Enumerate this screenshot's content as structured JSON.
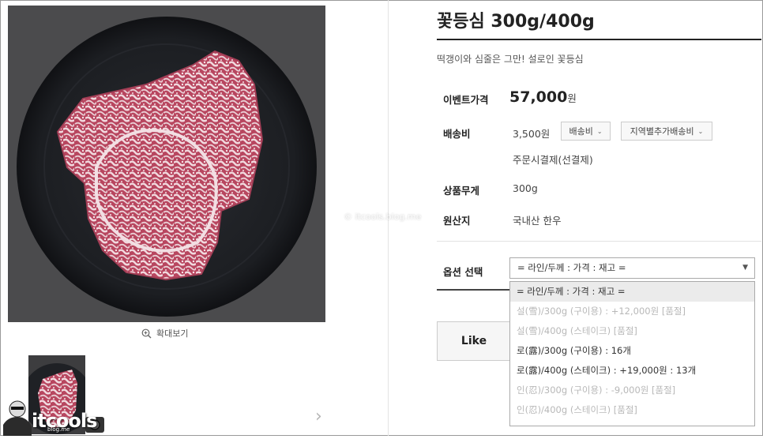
{
  "product": {
    "title": "꽃등심 300g/400g",
    "subtitle": "떡갱이와 심줄은 그만! 설로인 꽃등심"
  },
  "gallery": {
    "zoom_label": "확대보기",
    "next_icon": "chevron-right-icon"
  },
  "details": {
    "event_price_label": "이벤트가격",
    "event_price": "57,000",
    "price_unit": "원",
    "shipping_label": "배송비",
    "shipping_value": "3,500원",
    "shipping_select": "배송비",
    "regional_select": "지역별추가배송비",
    "shipping_note": "주문시결제(선결제)",
    "weight_label": "상품무게",
    "weight_value": "300g",
    "origin_label": "원산지",
    "origin_value": "국내산 한우"
  },
  "options": {
    "label": "옵션 선택",
    "selected": "= 라인/두께 : 가격 : 재고 =",
    "items": [
      "= 라인/두께 : 가격 : 재고 =",
      "설(雪)/300g (구이용) : +12,000원 [품절]",
      "설(雪)/400g (스테이크) [품절]",
      "로(露)/300g (구이용) : 16개",
      "로(露)/400g (스테이크) : +19,000원 : 13개",
      "인(忍)/300g (구이용) : -9,000원 [품절]",
      "인(忍)/400g (스테이크) [품절]"
    ]
  },
  "actions": {
    "like_label": "Like"
  },
  "watermark": {
    "center_text": "© itcools.blog.me",
    "logo_text": "itcools",
    "logo_sub": "blog.me"
  },
  "colors": {
    "accent": "#222222",
    "disabled_text": "#b8b8b8",
    "plate": "#1d1f23"
  }
}
